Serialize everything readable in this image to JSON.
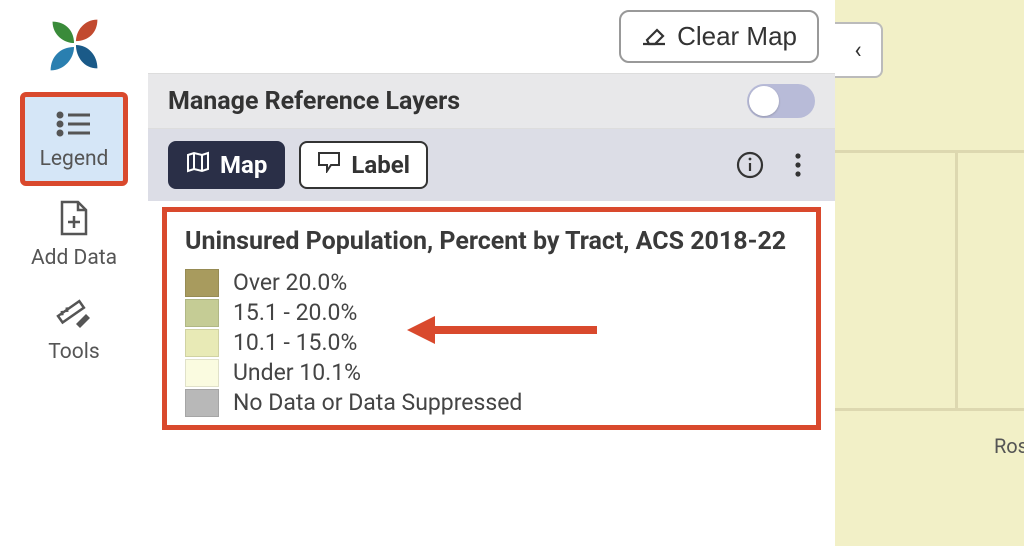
{
  "sidebar": {
    "items": [
      {
        "label": "Legend"
      },
      {
        "label": "Add Data"
      },
      {
        "label": "Tools"
      }
    ]
  },
  "toolbar": {
    "clear_label": "Clear Map"
  },
  "reference_layers": {
    "title": "Manage Reference Layers",
    "enabled": false
  },
  "layer_tabs": {
    "map": "Map",
    "label": "Label"
  },
  "legend": {
    "title": "Uninsured Population, Percent by Tract, ACS 2018-22",
    "items": [
      {
        "color": "#a89b5e",
        "label": "Over 20.0%"
      },
      {
        "color": "#c5cc95",
        "label": "15.1 - 20.0%"
      },
      {
        "color": "#e8eab6",
        "label": "10.1 - 15.0%"
      },
      {
        "color": "#fafbe0",
        "label": "Under 10.1%"
      },
      {
        "color": "#b8b8b8",
        "label": "No Data or Data Suppressed"
      }
    ],
    "highlight_index": 1
  },
  "map": {
    "visible_label": "Ros"
  },
  "collapse_glyph": "‹"
}
